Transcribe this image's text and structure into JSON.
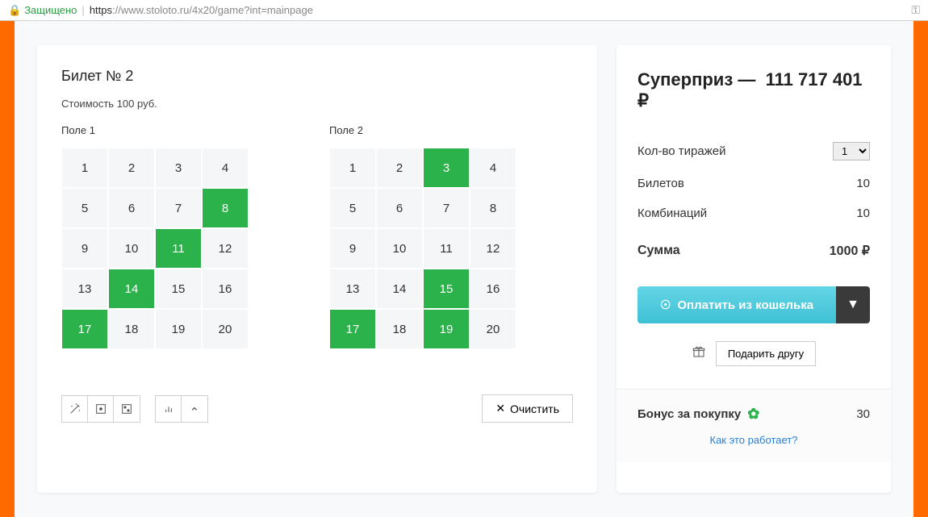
{
  "browser": {
    "secure_label": "Защищено",
    "url_proto": "https",
    "url_rest": "://www.stoloto.ru/4x20/game?int=mainpage"
  },
  "ticket": {
    "title": "Билет № 2",
    "cost": "Стоимость 100 руб.",
    "field1_label": "Поле 1",
    "field2_label": "Поле 2",
    "field1_selected": [
      8,
      11,
      14,
      17
    ],
    "field2_selected": [
      3,
      15,
      17,
      19
    ],
    "cells": [
      "1",
      "2",
      "3",
      "4",
      "5",
      "6",
      "7",
      "8",
      "9",
      "10",
      "11",
      "12",
      "13",
      "14",
      "15",
      "16",
      "17",
      "18",
      "19",
      "20"
    ],
    "clear_label": "Очистить"
  },
  "summary": {
    "prize_label": "Суперприз —",
    "prize_amount": "111 717 401 ₽",
    "draws_label": "Кол-во тиражей",
    "draws_value": "1",
    "tickets_label": "Билетов",
    "tickets_value": "10",
    "combos_label": "Комбинаций",
    "combos_value": "10",
    "total_label": "Сумма",
    "total_value": "1000 ₽",
    "pay_label": "Оплатить из кошелька",
    "gift_label": "Подарить другу",
    "bonus_label": "Бонус за покупку",
    "bonus_value": "30",
    "bonus_link": "Как это работает?"
  }
}
